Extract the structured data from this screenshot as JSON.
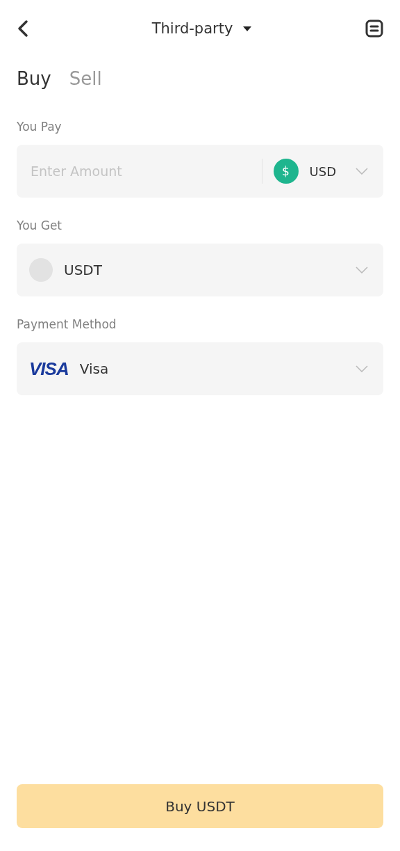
{
  "header": {
    "title": "Third-party"
  },
  "tabs": [
    {
      "label": "Buy",
      "selected": true
    },
    {
      "label": "Sell",
      "selected": false
    }
  ],
  "pay": {
    "label": "You Pay",
    "placeholder": "Enter Amount",
    "currency_symbol": "$",
    "currency": "USD"
  },
  "get": {
    "label": "You Get",
    "asset": "USDT"
  },
  "payment": {
    "label": "Payment Method",
    "logo_text": "VISA",
    "method": "Visa"
  },
  "submit": {
    "label": "Buy USDT"
  }
}
